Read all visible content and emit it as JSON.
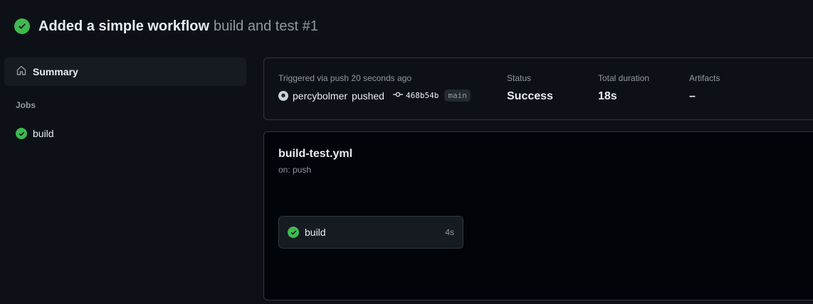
{
  "header": {
    "title": "Added a simple workflow",
    "subtitle": "build and test #1",
    "status_icon": "check-circle-fill-icon",
    "status_color": "#3fb950"
  },
  "sidebar": {
    "summary_label": "Summary",
    "jobs_heading": "Jobs",
    "jobs": [
      {
        "label": "build",
        "status": "success"
      }
    ]
  },
  "run_summary": {
    "trigger_label": "Triggered via push 20 seconds ago",
    "actor": "percybolmer",
    "action": "pushed",
    "commit": "468b54b",
    "branch": "main",
    "status_label": "Status",
    "status_value": "Success",
    "duration_label": "Total duration",
    "duration_value": "18s",
    "artifacts_label": "Artifacts",
    "artifacts_value": "–"
  },
  "workflow": {
    "file": "build-test.yml",
    "trigger": "on: push",
    "jobs": [
      {
        "name": "build",
        "duration": "4s",
        "status": "success"
      }
    ]
  }
}
